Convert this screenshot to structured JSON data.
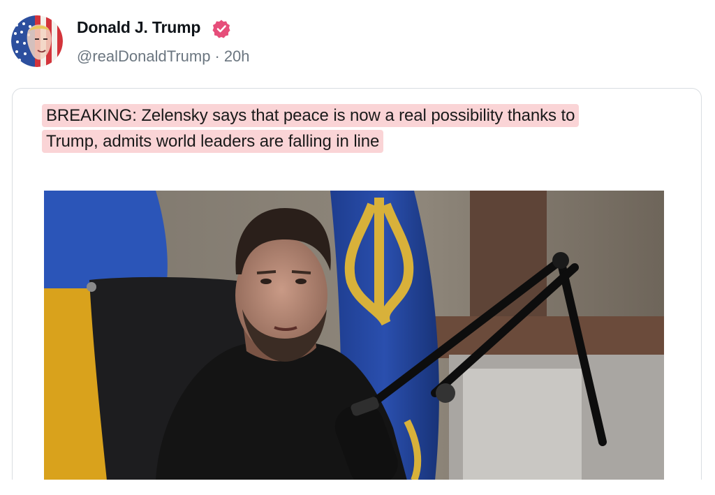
{
  "author": {
    "name": "Donald J. Trump",
    "handle": "@realDonaldTrump",
    "separator": "·",
    "time": "20h",
    "verified_badge_color": "#e64e7a"
  },
  "card": {
    "headline_line1": "BREAKING: Zelensky says that peace is now a real possibility thanks to",
    "headline_line2": "Trump, admits world leaders are falling in line",
    "highlight_color": "#fad4d6"
  },
  "icons": {
    "verified": "verified-badge-icon"
  }
}
